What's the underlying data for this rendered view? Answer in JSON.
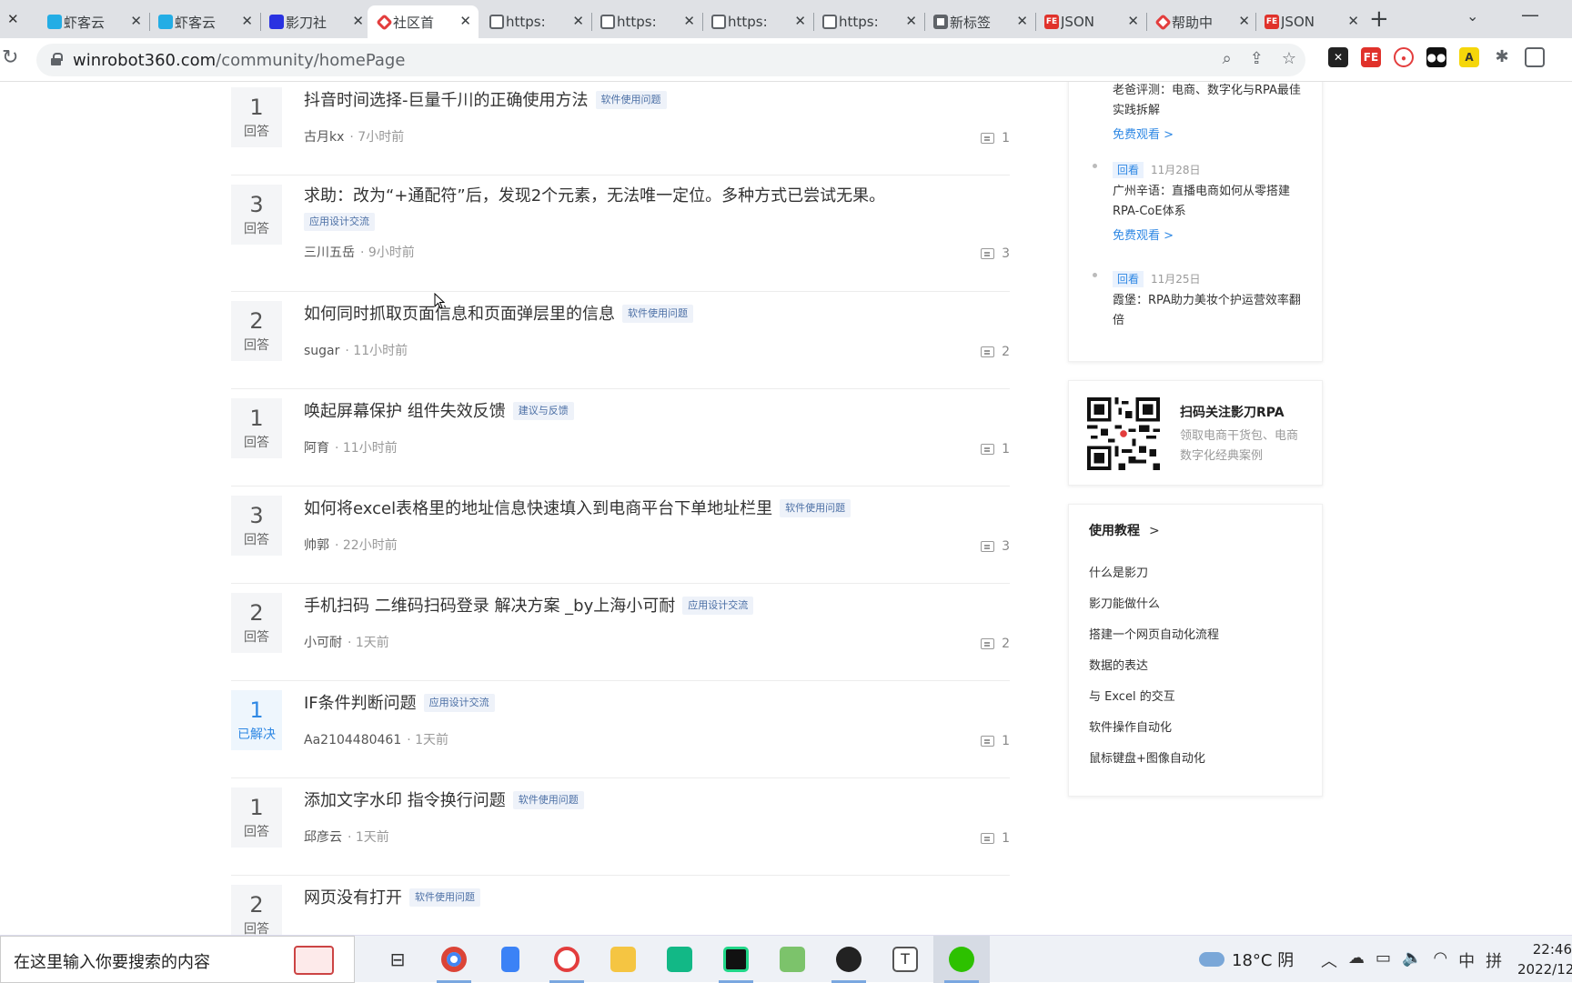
{
  "browser": {
    "tabs": [
      {
        "title": "",
        "icon": "close-icon"
      },
      {
        "title": "虾客云",
        "icon": "bilibili-icon"
      },
      {
        "title": "虾客云",
        "icon": "bilibili-icon"
      },
      {
        "title": "影刀社",
        "icon": "baidu-icon"
      },
      {
        "title": "社区首",
        "icon": "winrobot-pin-icon",
        "active": true
      },
      {
        "title": "https:",
        "icon": "globe-icon"
      },
      {
        "title": "https:",
        "icon": "globe-icon"
      },
      {
        "title": "https:",
        "icon": "globe-icon"
      },
      {
        "title": "https:",
        "icon": "globe-icon"
      },
      {
        "title": "新标签",
        "icon": "chrome-icon"
      },
      {
        "title": "JSON",
        "icon": "fe-icon"
      },
      {
        "title": "帮助中",
        "icon": "winrobot-pin-icon"
      },
      {
        "title": "JSON",
        "icon": "fe-icon"
      }
    ],
    "url_host": "winrobot360.com",
    "url_path": "/community/homePage"
  },
  "questions": [
    {
      "count": "1",
      "count_label": "回答",
      "title": "抖音时间选择-巨量千川的正确使用方法",
      "tag": "软件使用问题",
      "author": "古月kx",
      "time": "· 7小时前",
      "comments": "1"
    },
    {
      "count": "3",
      "count_label": "回答",
      "title": "求助：改为“+通配符”后，发现2个元素，无法唯一定位。多种方式已尝试无果。",
      "tag": "应用设计交流",
      "author": "三川五岳",
      "time": "· 9小时前",
      "comments": "3"
    },
    {
      "count": "2",
      "count_label": "回答",
      "title": "如何同时抓取页面信息和页面弹层里的信息",
      "tag": "软件使用问题",
      "author": "sugar",
      "time": "· 11小时前",
      "comments": "2"
    },
    {
      "count": "1",
      "count_label": "回答",
      "title": "唤起屏幕保护 组件失效反馈",
      "tag": "建议与反馈",
      "author": "阿育",
      "time": "· 11小时前",
      "comments": "1"
    },
    {
      "count": "3",
      "count_label": "回答",
      "title": "如何将excel表格里的地址信息快速填入到电商平台下单地址栏里",
      "tag": "软件使用问题",
      "author": "帅郭",
      "time": "· 22小时前",
      "comments": "3"
    },
    {
      "count": "2",
      "count_label": "回答",
      "title": "手机扫码 二维码扫码登录 解决方案 _by上海小可耐",
      "tag": "应用设计交流",
      "author": "小可耐",
      "time": "· 1天前",
      "comments": "2"
    },
    {
      "count": "1",
      "count_label": "已解决",
      "title": "IF条件判断问题",
      "tag": "应用设计交流",
      "author": "Aa2104480461",
      "time": "· 1天前",
      "comments": "1"
    },
    {
      "count": "1",
      "count_label": "回答",
      "title": "添加文字水印 指令换行问题",
      "tag": "软件使用问题",
      "author": "邱彦云",
      "time": "· 1天前",
      "comments": "1"
    },
    {
      "count": "2",
      "count_label": "回答",
      "title": "网页没有打开",
      "tag": "软件使用问题",
      "author": "",
      "time": "",
      "comments": ""
    }
  ],
  "sidebar": {
    "live": [
      {
        "badge": "",
        "date": "",
        "title": "老爸评测：电商、数字化与RPA最佳实践拆解",
        "link": "免费观看 >"
      },
      {
        "badge": "回看",
        "date": "11月28日",
        "title": "广州辛语：直播电商如何从零搭建RPA-CoE体系",
        "link": "免费观看 >"
      },
      {
        "badge": "回看",
        "date": "11月25日",
        "title": "霞堡：RPA助力美妆个护运营效率翻倍",
        "link": ""
      }
    ],
    "qr_title": "扫码关注影刀RPA",
    "qr_sub": "领取电商干货包、电商数字化经典案例",
    "tutorial_head": "使用教程",
    "tutorials": [
      "什么是影刀",
      "影刀能做什么",
      "搭建一个网页自动化流程",
      "数据的表达",
      "与 Excel 的交互",
      "软件操作自动化",
      "鼠标键盘+图像自动化"
    ]
  },
  "taskbar": {
    "search_placeholder": "在这里输入你要搜索的内容",
    "weather": "18°C 阴",
    "ime_lang": "中",
    "ime_mode": "拼",
    "time": "22:46",
    "date": "2022/12"
  }
}
